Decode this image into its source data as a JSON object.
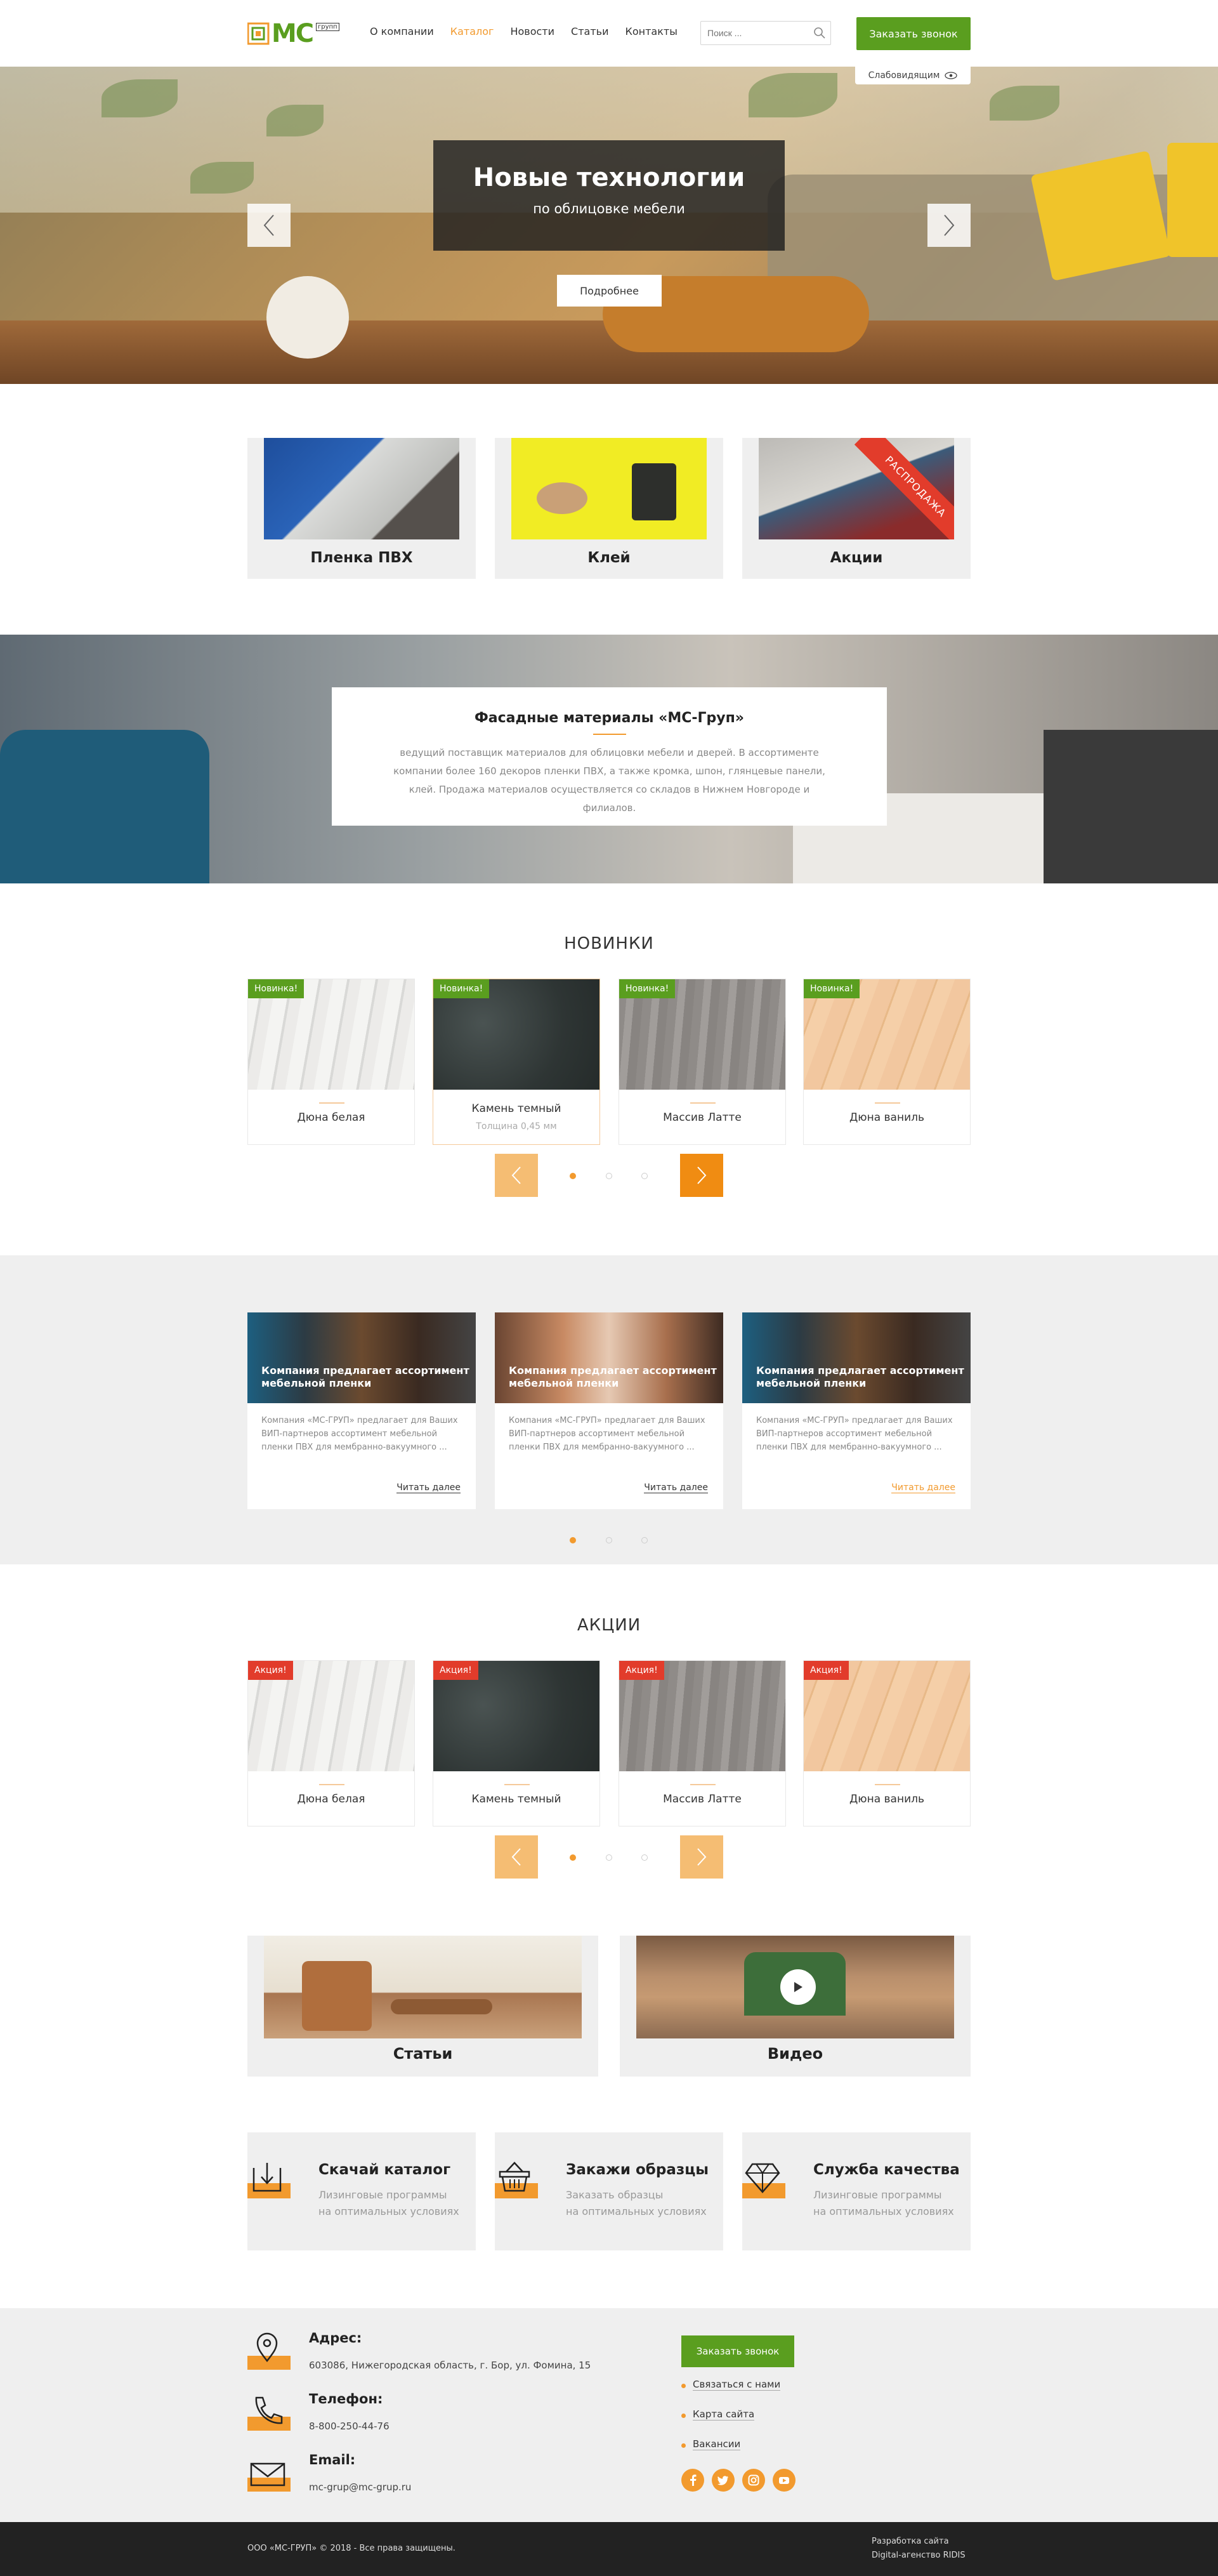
{
  "header": {
    "logo_text": "МС",
    "logo_sub": "групп",
    "nav": [
      "О компании",
      "Каталог",
      "Новости",
      "Статьи",
      "Контакты"
    ],
    "search_placeholder": "Поиск ...",
    "call_button": "Заказать звонок",
    "accent_color": "#f29a2e",
    "green_color": "#5a9e1f"
  },
  "hero": {
    "vision_label": "Слабовидящим",
    "title": "Новые технологии",
    "subtitle": "по облицовке мебели",
    "button": "Подробнее"
  },
  "categories": [
    {
      "label": "Пленка ПВХ"
    },
    {
      "label": "Клей"
    },
    {
      "label": "Акции",
      "ribbon": "РАСПРОДАЖА"
    }
  ],
  "about": {
    "title": "Фасадные материалы «МС-Груп»",
    "text": "ведущий поставщик материалов для облицовки мебели и дверей. В ассортименте компании более 160 декоров пленки ПВХ, а также кромка, шпон, глянцевые панели, клей. Продажа материалов осуществляется со складов в Нижнем Новгороде и филиалов."
  },
  "novelties": {
    "title": "НОВИНКИ",
    "badge": "Новинка!",
    "items": [
      {
        "name": "Дюна белая"
      },
      {
        "name": "Камень темный",
        "thickness": "Толщина 0,45 мм"
      },
      {
        "name": "Массив Латте"
      },
      {
        "name": "Дюна ваниль"
      }
    ]
  },
  "news": {
    "items": [
      {
        "title": "Компания предлагает ассортимент мебельной пленки",
        "text": "Компания «МС-ГРУП» предлагает для Ваших ВИП-партнеров ассортимент мебельной пленки ПВХ для мембранно-вакуумного ...",
        "more": "Читать далее"
      },
      {
        "title": "Компания предлагает ассортимент мебельной пленки",
        "text": "Компания «МС-ГРУП» предлагает для Ваших ВИП-партнеров ассортимент мебельной пленки ПВХ для мембранно-вакуумного ...",
        "more": "Читать далее"
      },
      {
        "title": "Компания предлагает ассортимент мебельной пленки",
        "text": "Компания «МС-ГРУП» предлагает для Ваших ВИП-партнеров ассортимент мебельной пленки ПВХ для мембранно-вакуумного ...",
        "more": "Читать далее"
      }
    ]
  },
  "promos": {
    "title": "АКЦИИ",
    "badge": "Акция!",
    "items": [
      {
        "name": "Дюна белая"
      },
      {
        "name": "Камень темный"
      },
      {
        "name": "Массив Латте"
      },
      {
        "name": "Дюна ваниль"
      }
    ]
  },
  "media": {
    "articles": "Статьи",
    "video": "Видео"
  },
  "features": [
    {
      "title": "Скачай каталог",
      "line1": "Лизинговые программы",
      "line2": "на оптимальных условиях",
      "icon": "download-icon"
    },
    {
      "title": "Закажи образцы",
      "line1": "Заказать образцы",
      "line2": "на оптимальных условиях",
      "icon": "basket-icon"
    },
    {
      "title": "Служба качества",
      "line1": "Лизинговые программы",
      "line2": "на оптимальных условиях",
      "icon": "diamond-icon"
    }
  ],
  "footer": {
    "address_label": "Адрес:",
    "address": "603086, Нижегородская область, г. Бор, ул. Фомина, 15",
    "phone_label": "Телефон:",
    "phone": "8-800-250-44-76",
    "email_label": "Email:",
    "email": "mc-grup@mc-grup.ru",
    "call_button": "Заказать звонок",
    "links": [
      "Связаться с нами",
      "Карта сайта",
      "Вакансии"
    ],
    "copyright": "ООО «МС-ГРУП» © 2018 - Все права защищены.",
    "dev_line1": "Разработка сайта",
    "dev_line2": "Digital-агенство RIDIS"
  }
}
